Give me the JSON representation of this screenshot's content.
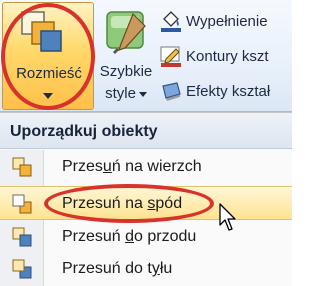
{
  "ribbon": {
    "arrange_label": "Rozmieść",
    "quick_styles_line1": "Szybkie",
    "quick_styles_line2": "style",
    "fill_label": "Wypełnienie",
    "outline_label": "Kontury kszt",
    "effects_label": "Efekty kształ"
  },
  "menu": {
    "header": "Uporządkuj obiekty",
    "items": [
      {
        "label_pre": "Przes",
        "label_key": "u",
        "label_post": "ń na wierzch"
      },
      {
        "label_pre": "Przesuń na ",
        "label_key": "s",
        "label_post": "pód"
      },
      {
        "label_pre": "Przesuń ",
        "label_key": "d",
        "label_post": "o przodu"
      },
      {
        "label_pre": "Przesuń do t",
        "label_key": "y",
        "label_post": "łu"
      }
    ]
  },
  "colors": {
    "highlight_oval": "#d8332b",
    "ribbon_active": "#ffd869",
    "menu_hover": "#ffe391",
    "accent_blue": "#2c5aa0"
  },
  "icons": {
    "arrange": "arrange-icon",
    "quick_styles": "paintbrush-icon",
    "fill": "paint-bucket-icon",
    "outline": "pencil-icon",
    "effects": "shape-effects-icon",
    "bring_to_front": "bring-to-front-icon",
    "send_to_back": "send-to-back-icon",
    "bring_forward": "bring-forward-icon",
    "send_backward": "send-backward-icon",
    "cursor": "mouse-cursor-icon"
  }
}
